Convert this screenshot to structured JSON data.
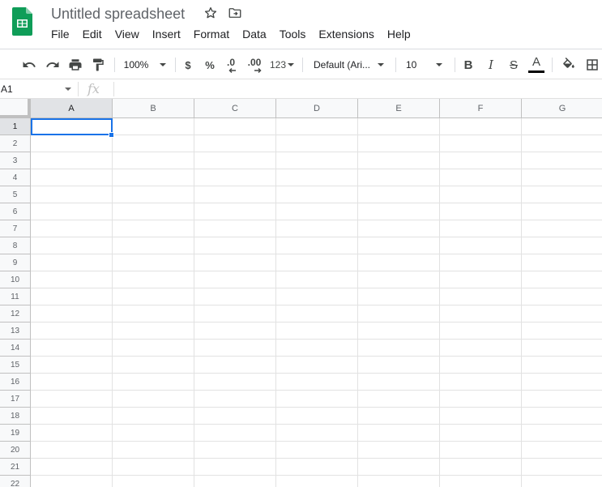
{
  "document": {
    "title": "Untitled spreadsheet"
  },
  "menu": {
    "items": [
      "File",
      "Edit",
      "View",
      "Insert",
      "Format",
      "Data",
      "Tools",
      "Extensions",
      "Help"
    ]
  },
  "toolbar": {
    "zoom": "100%",
    "currency_label": "$",
    "percent_label": "%",
    "decrease_decimal_label": ".0",
    "increase_decimal_label": ".00",
    "number_format_label": "123",
    "font_family": "Default (Ari...",
    "font_size": "10",
    "bold_label": "B",
    "italic_label": "I",
    "strikethrough_label": "S",
    "text_color_label": "A",
    "text_color": "#000000",
    "icons": [
      "undo-icon",
      "redo-icon",
      "print-icon",
      "paint-format-icon",
      "fill-color-icon",
      "borders-icon"
    ]
  },
  "formula_bar": {
    "cell_reference": "A1",
    "fx_label": "fx",
    "value": ""
  },
  "sheet": {
    "columns": [
      "A",
      "B",
      "C",
      "D",
      "E",
      "F",
      "G"
    ],
    "rows": [
      "1",
      "2",
      "3",
      "4",
      "5",
      "6",
      "7",
      "8",
      "9",
      "10",
      "11",
      "12",
      "13",
      "14",
      "15",
      "16",
      "17",
      "18",
      "19",
      "20",
      "21",
      "22"
    ],
    "selected_cell": "A1"
  },
  "colors": {
    "brand_green": "#0f9d58",
    "selection_blue": "#1a73e8"
  }
}
